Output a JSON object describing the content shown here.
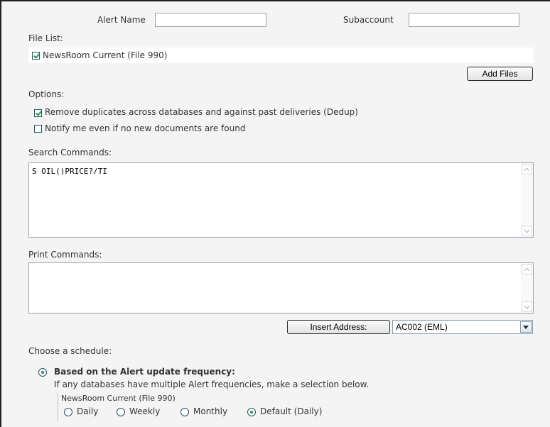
{
  "alert_name": {
    "label": "Alert Name",
    "value": ""
  },
  "subaccount": {
    "label": "Subaccount",
    "value": ""
  },
  "file_list": {
    "label": "File List:",
    "items": [
      {
        "label": "NewsRoom Current (File 990)",
        "checked": true
      }
    ],
    "add_button": "Add Files"
  },
  "options": {
    "label": "Options:",
    "dedup": {
      "label": "Remove duplicates across databases and against past deliveries (Dedup)",
      "checked": true
    },
    "notify": {
      "label": "Notify me even if no new documents are found",
      "checked": false
    }
  },
  "search_commands": {
    "label": "Search Commands:",
    "value": "S OIL()PRICE?/TI"
  },
  "print_commands": {
    "label": "Print Commands:",
    "value": ""
  },
  "insert_address": {
    "button": "Insert Address:",
    "selected": "AC002 (EML)"
  },
  "schedule": {
    "label": "Choose a schedule:",
    "option_frequency": {
      "title": "Based on the Alert update frequency:",
      "hint": "If any databases have multiple Alert frequencies, make a selection below.",
      "database": "NewsRoom Current (File 990)",
      "choices": [
        "Daily",
        "Weekly",
        "Monthly",
        "Default (Daily)"
      ],
      "selected": "Default (Daily)"
    }
  },
  "icons": {
    "scroll_up": "scroll-up-arrow-icon",
    "scroll_down": "scroll-down-arrow-icon",
    "dropdown": "chevron-down-icon"
  },
  "colors": {
    "check": "#21a121",
    "border": "#1c5180"
  }
}
